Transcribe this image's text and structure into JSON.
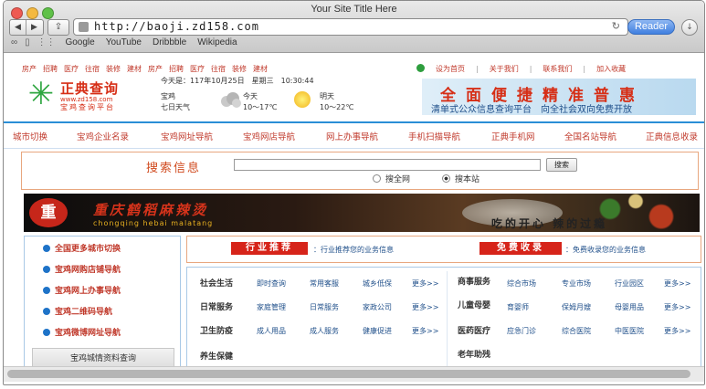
{
  "window": {
    "title": "Your Site Title Here",
    "url": "http://baoji.zd158.com",
    "reader_label": "Reader",
    "bookmarks": [
      "Google",
      "YouTube",
      "Dribbble",
      "Wikipedia"
    ]
  },
  "top_links_left": [
    "房产",
    "招聘",
    "医疗",
    "往宿",
    "装修",
    "建材",
    "房产",
    "招聘",
    "医疗",
    "往宿",
    "装修",
    "建材"
  ],
  "top_links_right": [
    "设为首页",
    "关于我们",
    "联系我们",
    "加入收藏"
  ],
  "logo": {
    "name": "正典查询",
    "url": "www.zd158.com",
    "platform": "宝鸡查询平台"
  },
  "date_text": "今天是：117年10月25日　星期三　10:30:44",
  "weather": {
    "city": "宝鸡",
    "days_label": "七日天气",
    "today_label": "今天",
    "today_temp": "10～17℃",
    "tomorrow_label": "明天",
    "tomorrow_temp": "10～22℃"
  },
  "banner": {
    "title": "全面便捷精准普惠",
    "subtitle": "清单式公众信息查询平台　向全社会双向免费开放"
  },
  "nav": [
    "城市切换",
    "宝鸡企业名录",
    "宝鸡网址导航",
    "宝鸡网店导航",
    "网上办事导航",
    "手机扫描导航",
    "正典手机网",
    "全国名站导航",
    "正典信息收录"
  ],
  "search": {
    "label": "搜索信息",
    "button": "搜索",
    "option_all": "搜全网",
    "option_site": "搜本站"
  },
  "ad": {
    "logo_text": "重",
    "name": "重庆鹤稻麻辣烫",
    "sub": "chongqing hebai malatang",
    "slogan": "吃的开心 辣的过瘾"
  },
  "left_menu": [
    "全国更多城市切换",
    "宝鸡网购店铺导航",
    "宝鸡网上办事导航",
    "宝鸡二维码导航",
    "宝鸡微博网址导航"
  ],
  "left_footer": "宝鸡城情资料查询",
  "promo": {
    "tag1": "行业推荐",
    "text1": "：行业推荐您的业务信息",
    "tag2": "免费收录",
    "text2": "：免费收录您的业务信息"
  },
  "grid_left": [
    {
      "head": "社会生活",
      "items": [
        "即时查询",
        "常用客服",
        "城乡低保",
        "更多>>"
      ]
    },
    {
      "head": "日常服务",
      "items": [
        "家庭管理",
        "日常服务",
        "家政公司",
        "更多>>"
      ]
    },
    {
      "head": "卫生防疫",
      "items": [
        "成人用品",
        "成人服务",
        "健康促进",
        "更多>>"
      ]
    },
    {
      "head": "养生保健",
      "items": []
    }
  ],
  "grid_right": [
    {
      "head": "商事服务",
      "items": [
        "综合市场",
        "专业市场",
        "行业园区",
        "更多>>"
      ]
    },
    {
      "head": "儿童母婴",
      "items": [
        "育婴师",
        "保姆月嫂",
        "母婴用品",
        "更多>>"
      ]
    },
    {
      "head": "医药医疗",
      "items": [
        "应急门诊",
        "综合医院",
        "中医医院",
        "更多>>"
      ]
    },
    {
      "head": "老年助残",
      "items": []
    }
  ],
  "colors": {
    "accent_red": "#d62e16",
    "link_blue": "#1f4f8a",
    "nav_blue": "#2a8ed6"
  }
}
